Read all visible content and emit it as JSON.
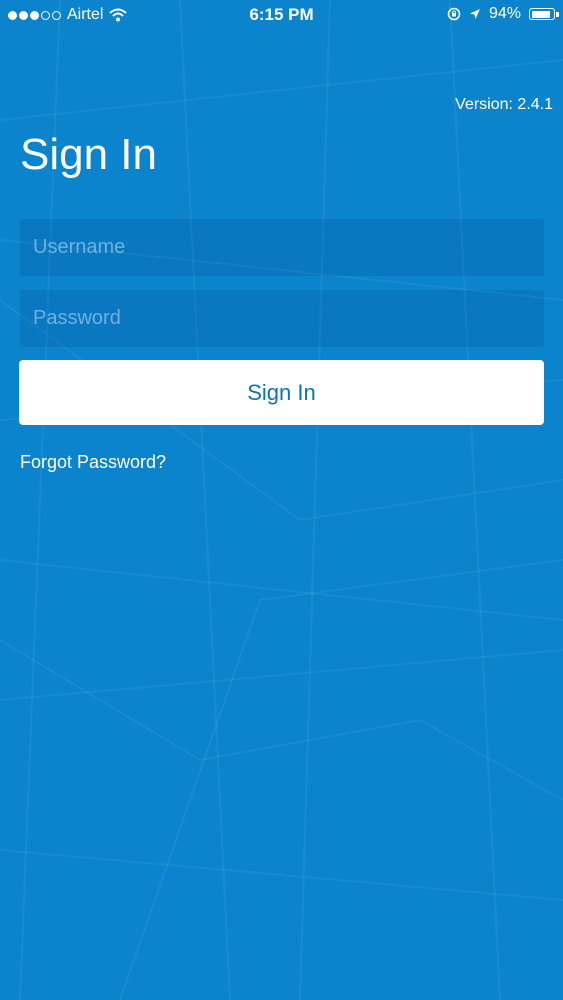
{
  "status_bar": {
    "carrier": "Airtel",
    "time": "6:15 PM",
    "battery_percent": "94%",
    "battery_level": 0.94,
    "signal_bars_filled": 3,
    "signal_bars_total": 5,
    "icons": [
      "wifi-icon",
      "rotation-lock-icon",
      "location-arrow-icon",
      "battery-icon"
    ]
  },
  "version_text": "Version: 2.4.1",
  "page_title": "Sign In",
  "form": {
    "username_placeholder": "Username",
    "password_placeholder": "Password",
    "submit_label": "Sign In"
  },
  "forgot_password_label": "Forgot Password?",
  "colors": {
    "background": "#0b84cd",
    "button_bg": "#ffffff",
    "button_text": "#0b74b8"
  }
}
